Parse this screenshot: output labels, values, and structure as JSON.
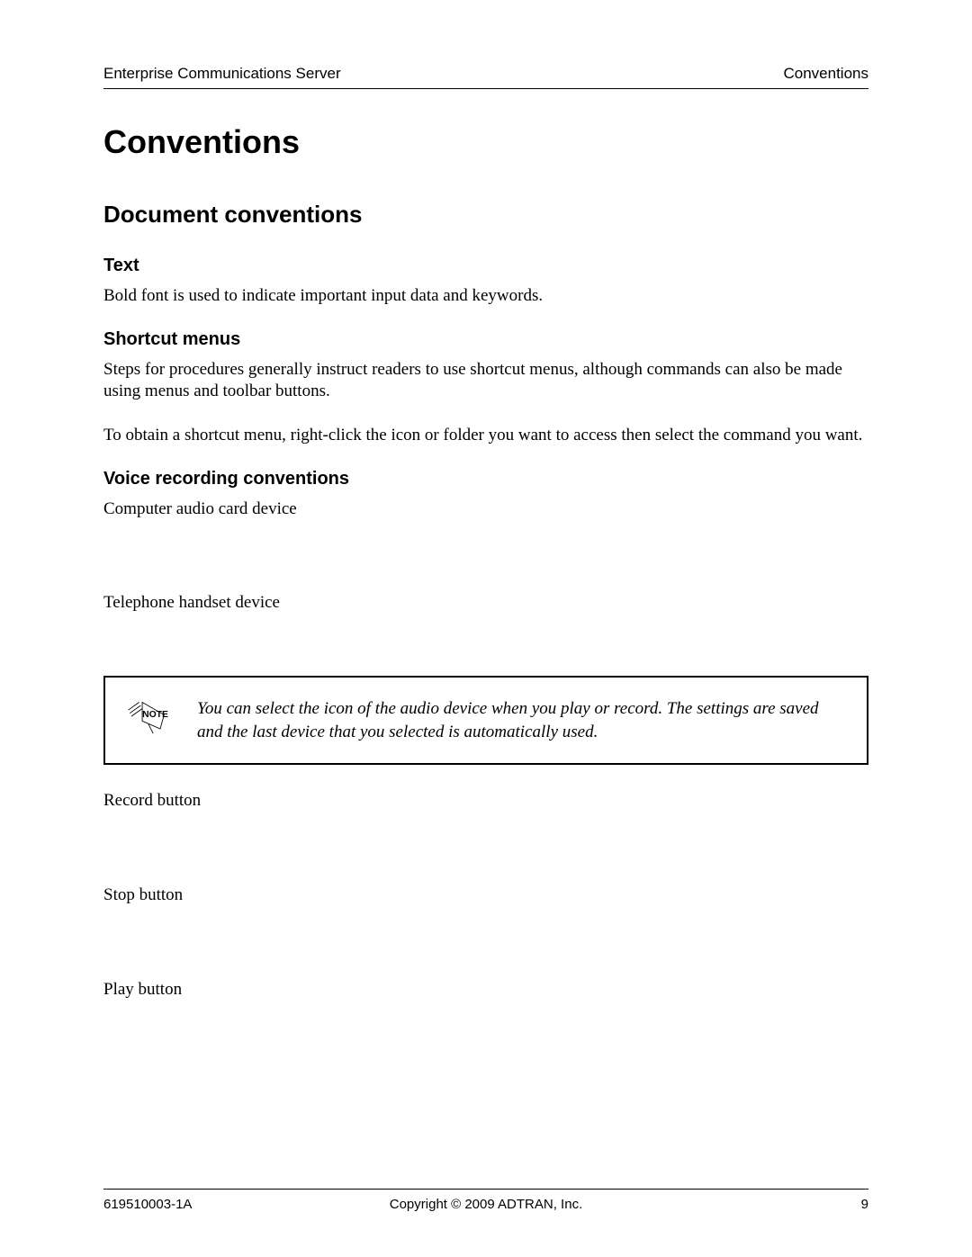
{
  "header": {
    "left": "Enterprise Communications Server",
    "right": "Conventions"
  },
  "title_h1": "Conventions",
  "title_h2": "Document conventions",
  "sections": {
    "text": {
      "heading": "Text",
      "p1": "Bold font is used to indicate important input data and keywords."
    },
    "shortcut": {
      "heading": "Shortcut menus",
      "p1": "Steps for procedures generally instruct readers to use shortcut menus, although commands can also be made using menus and toolbar buttons.",
      "p2": "To obtain a shortcut menu, right-click the icon or folder you want to access then select the command you want."
    },
    "voice": {
      "heading": "Voice recording conventions",
      "item1": "Computer audio card device",
      "item2": "Telephone handset device",
      "note": "You can select the icon of the audio device when you play or record. The settings are saved and the last device that you selected is automatically used.",
      "item3": "Record button",
      "item4": "Stop button",
      "item5": "Play button"
    }
  },
  "note_label": "NOTE",
  "footer": {
    "left": "619510003-1A",
    "center": "Copyright © 2009 ADTRAN, Inc.",
    "right": "9"
  }
}
